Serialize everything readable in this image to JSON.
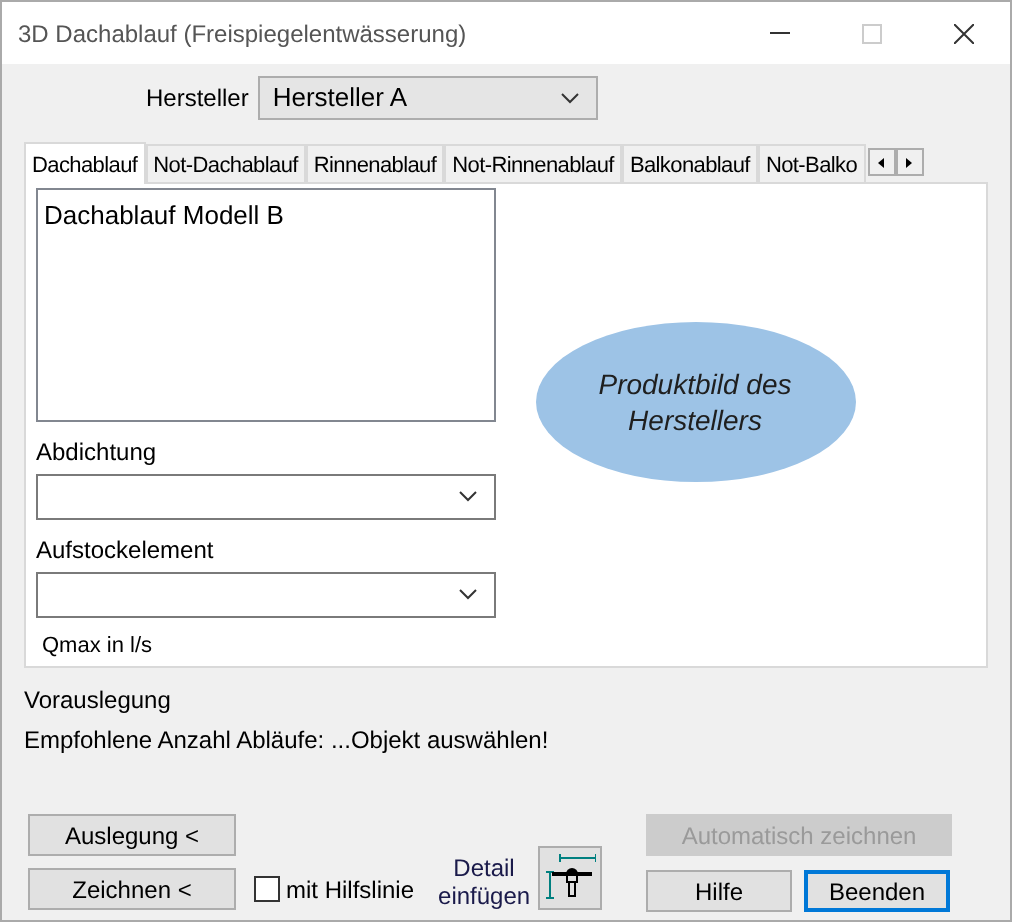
{
  "window": {
    "title": "3D Dachablauf (Freispiegelentwässerung)"
  },
  "manufacturer": {
    "label": "Hersteller",
    "value": "Hersteller A"
  },
  "tabs": [
    {
      "label": "Dachablauf",
      "selected": true
    },
    {
      "label": "Not-Dachablauf",
      "selected": false
    },
    {
      "label": "Rinnenablauf",
      "selected": false
    },
    {
      "label": "Not-Rinnenablauf",
      "selected": false
    },
    {
      "label": "Balkonablauf",
      "selected": false
    },
    {
      "label": "Not-Balko",
      "selected": false
    }
  ],
  "model_list": {
    "items": [
      {
        "label": "Dachablauf Modell B",
        "selected": false
      }
    ]
  },
  "fields": [
    {
      "label": "Abdichtung"
    },
    {
      "label": "Aufstockelement"
    }
  ],
  "qmax_label": "Qmax in l/s",
  "product_image": {
    "text": "Produktbild des Herstellers"
  },
  "preliminary": {
    "heading": "Vorauslegung",
    "text": "Empfohlene Anzahl Abläufe: ...Objekt auswählen!"
  },
  "buttons": {
    "design": {
      "label": "Auslegung <"
    },
    "draw": {
      "label": "Zeichnen <"
    },
    "auto_draw": {
      "label": "Automatisch zeichnen",
      "disabled": true
    },
    "help": {
      "label": "Hilfe"
    },
    "close": {
      "label": "Beenden",
      "default": true
    }
  },
  "helper_line": {
    "label": "mit Hilfslinie",
    "checked": false
  },
  "detail_insert": {
    "label": "Detail einfügen"
  }
}
